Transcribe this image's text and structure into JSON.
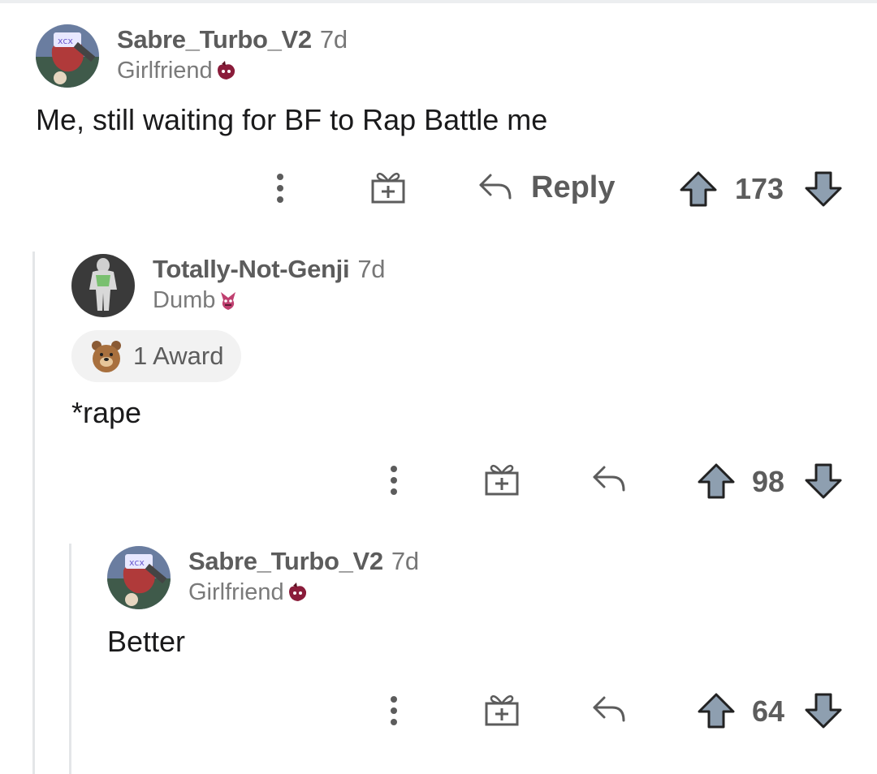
{
  "comments": [
    {
      "username": "Sabre_Turbo_V2",
      "age": "7d",
      "flair": "Girlfriend",
      "flair_emoji": "girlfriend-flair-icon",
      "body": "Me, still waiting for BF to Rap Battle me",
      "reply_label": "Reply",
      "score": "173",
      "avatar_color": "#5a6a8a"
    },
    {
      "username": "Totally-Not-Genji",
      "age": "7d",
      "flair": "Dumb",
      "flair_emoji": "dumb-flair-icon",
      "award": "1 Award",
      "body": "*rape",
      "score": "98",
      "avatar_color": "#3a3a3a"
    },
    {
      "username": "Sabre_Turbo_V2",
      "age": "7d",
      "flair": "Girlfriend",
      "flair_emoji": "girlfriend-flair-icon",
      "body": "Better",
      "score": "64",
      "avatar_color": "#5a6a8a"
    }
  ],
  "colors": {
    "icon_gray": "#5c5c5c",
    "vote_fill": "#8e9fb0",
    "thread_line": "#e4e6e8"
  }
}
